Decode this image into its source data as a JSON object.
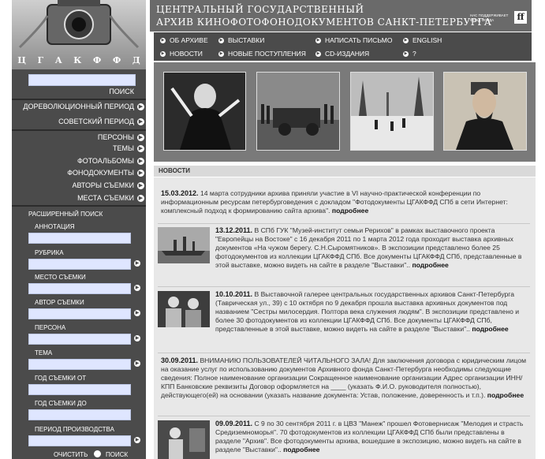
{
  "header": {
    "title_line1": "ЦЕНТРАЛЬНЫЙ ГОСУДАРСТВЕННЫЙ",
    "title_line2": "АРХИВ КИНОФОТОФОНОДОКУМЕНТОВ САНКТ-ПЕТЕРБУРГА",
    "support_text": "НАС ПОДДЕРЖИВАЕТ ФОНД ФОРДА",
    "ff_logo": "ff"
  },
  "logo": {
    "letters": [
      "Ц",
      "Г",
      "А",
      "К",
      "Ф",
      "Ф",
      "Д"
    ]
  },
  "menu": {
    "items": [
      "ОБ АРХИВЕ",
      "ВЫСТАВКИ",
      "НАПИСАТЬ ПИСЬМО",
      "ENGLISH",
      "НОВОСТИ",
      "НОВЫЕ ПОСТУПЛЕНИЯ",
      "CD-ИЗДАНИЯ",
      "?"
    ]
  },
  "search": {
    "button_label": "ПОИСК"
  },
  "left_nav": {
    "periods": [
      "ДОРЕВОЛЮЦИОННЫЙ ПЕРИОД",
      "СОВЕТСКИЙ ПЕРИОД"
    ],
    "sections": [
      "ПЕРСОНЫ",
      "ТЕМЫ",
      "ФОТОАЛЬБОМЫ",
      "ФОНОДОКУМЕНТЫ",
      "АВТОРЫ СЪЕМКИ",
      "МЕСТА СЪЕМКИ"
    ]
  },
  "advanced_search": {
    "title": "РАСШИРЕННЫЙ ПОИСК",
    "fields": [
      "АННОТАЦИЯ",
      "РУБРИКА",
      "МЕСТО СЪЕМКИ",
      "АВТОР СЪЕМКИ",
      "ПЕРСОНА",
      "ТЕМА",
      "ГОД СЪЕМКИ ОТ",
      "ГОД СЪЕМКИ ДО",
      "ПЕРИОД ПРОИЗВОДСТВА"
    ],
    "clear_label": "ОЧИСТИТЬ",
    "search_label": "ПОИСК"
  },
  "news": {
    "heading": "НОВОСТИ",
    "more_label": "подробнее",
    "items": [
      {
        "date": "15.03.2012.",
        "text": "14 марта сотрудники архива приняли участие в VI научно-практической конференции по информационным ресурсам петербурговедения с докладом \"Фотодокументы ЦГАКФФД СПб в сети Интернет: комплексный подход к формированию сайта архива\"."
      },
      {
        "date": "13.12.2011.",
        "text": "В СПб ГУК \"Музей-институт семьи Рерихов\" в рамках выставочного проекта \"Европейцы на Востоке\" с 16 декабря 2011 по 1 марта 2012 года проходит выставка архивных документов «На чужом берегу. С.Н.Сыромятников». В экспозиции представлено более 25 фотодокументов из коллекции ЦГАКФФД СПб. Все документы ЦГАКФФД СПб, представленные в этой выставке, можно видеть на сайте в разделе \"Выставки\".."
      },
      {
        "date": "10.10.2011.",
        "text": "В Выставочной галерее центральных государственных архивов Санкт-Петербурга (Таврическая ул., 39) с 10 октября по 9 декабря прошла выставка архивных документов под названием \"Сестры милосердия. Полтора века служения людям\". В экспозиции представлено и более 30 фотодокументов из коллекции ЦГАКФФД СПб. Все документы ЦГАКФФД СПб, представленные в этой выставке, можно видеть на сайте в разделе \"Выставки\".."
      },
      {
        "date": "30.09.2011.",
        "text": "ВНИМАНИЮ ПОЛЬЗОВАТЕЛЕЙ ЧИТАЛЬНОГО ЗАЛА! Для заключения договора с юридическим лицом на оказание услуг по использованию документов Архивного фонда Санкт-Петербурга необходимы следующие сведения: Полное наименование организации Сокращенное наименование организации Адрес организации ИНН/КПП Банковские реквизиты Договор оформляется на ____ (указать Ф.И.О. руководителя полностью), действующего(ей) на основании (указать название документа: Устав, положение, доверенность и т.п.)."
      },
      {
        "date": "09.09.2011.",
        "text": "С 9 по 30 сентября 2011 г. в ЦВЗ \"Манеж\" прошел Фотовернисаж \"Мелодия и страсть Средиземноморья\". 70 фотодокументов из коллекции ЦГАКФФД СПб были представлены в разделе \"Архив\". Все фотодокументы архива, вошедшие в экспозицию, можно видеть на сайте в разделе \"Выставки\".."
      }
    ]
  },
  "colors": {
    "nav_bg": "#4b4b4b",
    "header_bg": "#6a6a6a",
    "news_bg": "#e8e8e8",
    "field_bg": "#dfe6ff"
  }
}
